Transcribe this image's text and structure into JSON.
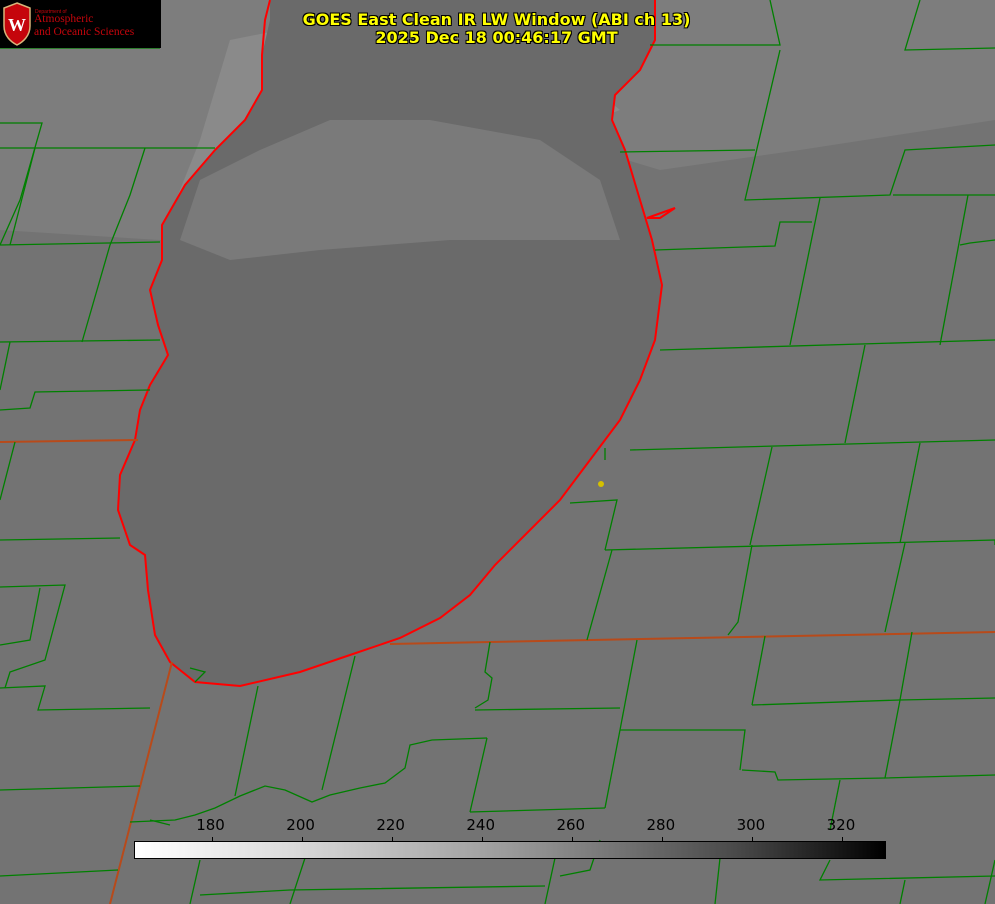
{
  "title": {
    "line1": "GOES East Clean IR LW Window (ABI ch 13)",
    "line2": "2025 Dec 18 00:46:17 GMT"
  },
  "logo": {
    "crest_letter": "W",
    "dept_small": "Department of",
    "line1": "Atmospheric",
    "line2": "and Oceanic Sciences",
    "color": "#c5050c"
  },
  "colorbar": {
    "ticks": [
      "180",
      "200",
      "220",
      "240",
      "260",
      "280",
      "300",
      "320"
    ],
    "tick_values": [
      180,
      200,
      220,
      240,
      260,
      280,
      300,
      320
    ],
    "min_value": 163,
    "max_value": 330,
    "colors": [
      "#ffffff",
      "#000000"
    ]
  },
  "map": {
    "boundary_color": "#008000",
    "coast_color": "#ff0000",
    "state_line_color": "#b84a1a",
    "marker_color": "#d4c000"
  }
}
